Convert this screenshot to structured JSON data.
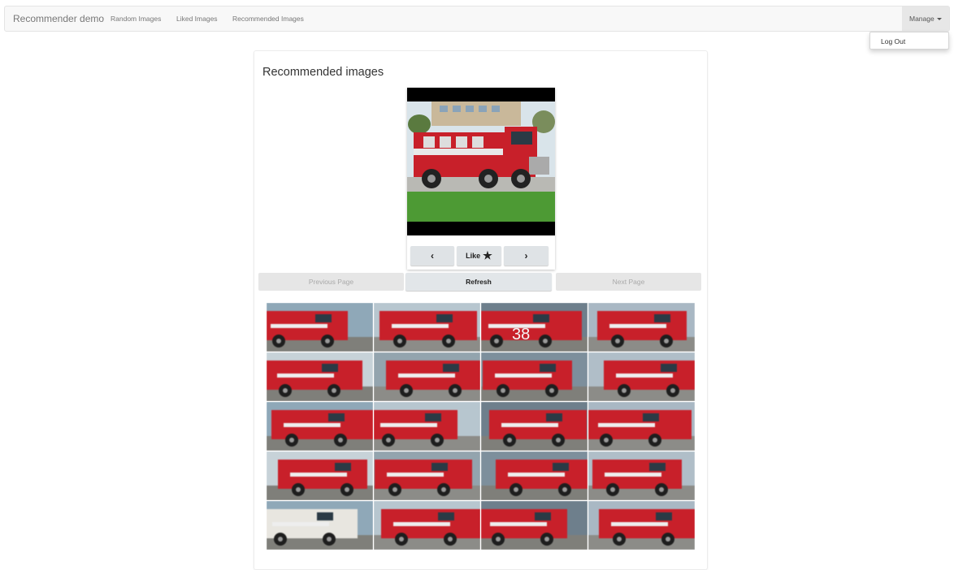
{
  "navbar": {
    "brand": "Recommender demo",
    "links": [
      "Random Images",
      "Liked Images",
      "Recommended Images"
    ],
    "manage_label": "Manage",
    "dropdown_items": [
      "Log Out"
    ]
  },
  "main": {
    "title": "Recommended images",
    "viewer": {
      "prev_icon": "‹",
      "like_label": "Like",
      "like_icon": "★",
      "next_icon": "›"
    },
    "buttons": {
      "previous_page": "Previous Page",
      "refresh": "Refresh",
      "next_page": "Next Page"
    },
    "grid": {
      "thumbnails": [
        {
          "name": "fire-truck-thumbnail",
          "number": ""
        },
        {
          "name": "fire-truck-thumbnail",
          "number": ""
        },
        {
          "name": "fire-truck-thumbnail",
          "number": "38"
        },
        {
          "name": "fire-truck-thumbnail",
          "number": ""
        },
        {
          "name": "fire-truck-thumbnail",
          "number": ""
        },
        {
          "name": "fire-truck-thumbnail",
          "number": ""
        },
        {
          "name": "fire-truck-thumbnail",
          "number": ""
        },
        {
          "name": "fire-truck-thumbnail",
          "number": ""
        },
        {
          "name": "fire-truck-thumbnail",
          "number": ""
        },
        {
          "name": "fire-truck-thumbnail",
          "number": ""
        },
        {
          "name": "fire-truck-thumbnail",
          "number": ""
        },
        {
          "name": "fire-truck-thumbnail",
          "number": ""
        },
        {
          "name": "fire-truck-thumbnail",
          "number": ""
        },
        {
          "name": "fire-truck-thumbnail",
          "number": ""
        },
        {
          "name": "fire-truck-thumbnail",
          "number": ""
        },
        {
          "name": "fire-truck-thumbnail",
          "number": ""
        },
        {
          "name": "fire-truck-thumbnail",
          "number": ""
        },
        {
          "name": "fire-truck-thumbnail",
          "number": ""
        },
        {
          "name": "fire-truck-thumbnail",
          "number": ""
        },
        {
          "name": "fire-truck-thumbnail",
          "number": ""
        }
      ]
    }
  },
  "colors": {
    "truck_red": "#c8202a",
    "navbar_bg": "#f8f8f8",
    "button_bg": "#dfe3e6"
  }
}
